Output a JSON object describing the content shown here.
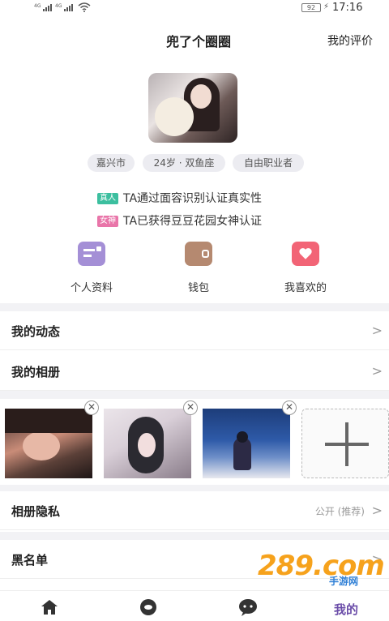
{
  "status_bar": {
    "signal1_label": "4G",
    "signal2_label": "4G",
    "battery": "92",
    "time": "17:16"
  },
  "header": {
    "nickname": "兜了个圈圈",
    "review_link": "我的评价"
  },
  "profile": {
    "tags": [
      "嘉兴市",
      "24岁 · 双鱼座",
      "自由职业者"
    ],
    "verifications": [
      {
        "badge": "真人",
        "text": "TA通过面容识别认证真实性",
        "color": "#3cbf9f"
      },
      {
        "badge": "女神",
        "text": "TA已获得豆豆花园女神认证",
        "color": "#e975a9"
      }
    ]
  },
  "shortcuts": [
    {
      "label": "个人资料",
      "icon": "profile-card-icon",
      "color": "#a48fd6"
    },
    {
      "label": "钱包",
      "icon": "wallet-icon",
      "color": "#b58970"
    },
    {
      "label": "我喜欢的",
      "icon": "heart-icon",
      "color": "#f26476"
    }
  ],
  "menu": {
    "moments": "我的动态",
    "album": "我的相册",
    "album_privacy": "相册隐私",
    "album_privacy_value": "公开 (推荐)",
    "blacklist": "黑名单",
    "chevron": ">"
  },
  "album_photos": [
    {
      "alt": "photo-1"
    },
    {
      "alt": "photo-2"
    },
    {
      "alt": "photo-3"
    }
  ],
  "tabbar": {
    "active_label": "我的",
    "items": [
      "home-icon",
      "discover-icon",
      "message-icon"
    ]
  },
  "watermark": {
    "main": "289.com",
    "sub": "手游网"
  }
}
